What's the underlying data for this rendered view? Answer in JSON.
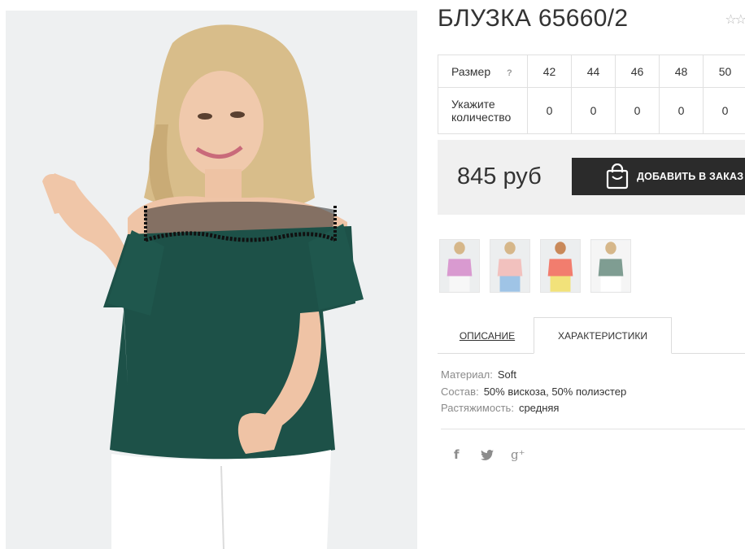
{
  "product": {
    "title": "БЛУЗКА 65660/2",
    "rating_icon": "star-outline-icon"
  },
  "size_table": {
    "size_label": "Размер",
    "help_mark": "?",
    "qty_label_line1": "Укажите",
    "qty_label_line2": "количество",
    "sizes": [
      "42",
      "44",
      "46",
      "48",
      "50"
    ],
    "quantities": [
      "0",
      "0",
      "0",
      "0",
      "0"
    ]
  },
  "price": {
    "amount": "845 руб",
    "order_button": "ДОБАВИТЬ В ЗАКАЗ"
  },
  "thumbnails": [
    {
      "color": "#d99ad0"
    },
    {
      "color": "#f2c1be"
    },
    {
      "color": "#f27d6e"
    },
    {
      "color": "#7f9d92"
    }
  ],
  "tabs": {
    "description": "ОПИСАНИЕ",
    "characteristics": "ХАРАКТЕРИСТИКИ"
  },
  "specs": [
    {
      "key": "Материал:",
      "value": "Soft"
    },
    {
      "key": "Состав:",
      "value": "50% вискоза, 50% полиэстер"
    },
    {
      "key": "Растяжимость:",
      "value": "средняя"
    }
  ],
  "social": {
    "facebook": "f",
    "twitter": "🐦",
    "google": "g⁺"
  },
  "colors": {
    "blouse": "#1d5148",
    "button_bg": "#2b2b2b",
    "price_bg": "#f0f0f0"
  }
}
